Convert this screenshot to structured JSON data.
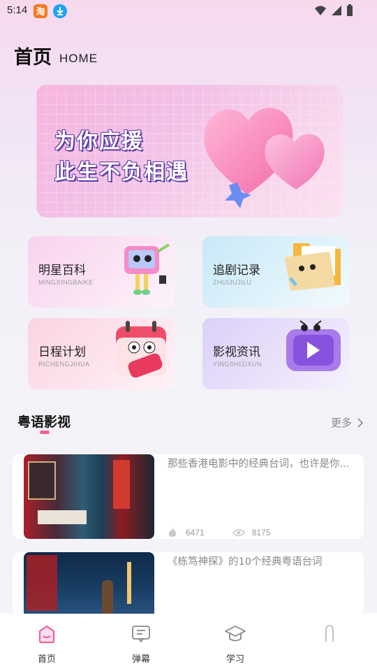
{
  "status_bar": {
    "time": "5:14",
    "icons": [
      "taobao-app-icon",
      "download-icon",
      "wifi-icon",
      "signal-icon",
      "battery-icon"
    ]
  },
  "header": {
    "title": "首页",
    "subtitle": "HOME"
  },
  "banner": {
    "line1": "为你应援",
    "line2": "此生不负相遇"
  },
  "tiles": [
    {
      "title": "明星百科",
      "subtitle": "MINGXINGBAIKE",
      "icon": "tv-robot-icon"
    },
    {
      "title": "追剧记录",
      "subtitle": "ZHUIJUJILU",
      "icon": "folder-icon"
    },
    {
      "title": "日程计划",
      "subtitle": "RICHENGJIHUA",
      "icon": "calendar-today-icon"
    },
    {
      "title": "影视资讯",
      "subtitle": "YINGSHIZIXUN",
      "icon": "video-tv-icon"
    }
  ],
  "section": {
    "title": "粤语影视",
    "more": "更多"
  },
  "articles": [
    {
      "title": "那些香港电影中的经典台词，也许是你...",
      "likes": "6471",
      "views": "8175"
    },
    {
      "title": "《栋笃神探》的10个经典粤语台词"
    }
  ],
  "tabbar": {
    "items": [
      {
        "label": "首页",
        "icon": "home-icon",
        "active": true
      },
      {
        "label": "弹幕",
        "icon": "danmaku-icon",
        "active": false
      },
      {
        "label": "学习",
        "icon": "graduation-cap-icon",
        "active": false
      },
      {
        "label": "",
        "icon": "profile-icon",
        "active": false
      }
    ]
  },
  "colors": {
    "accent": "#f0609e",
    "banner_text_outline": "#5c3aa8"
  }
}
